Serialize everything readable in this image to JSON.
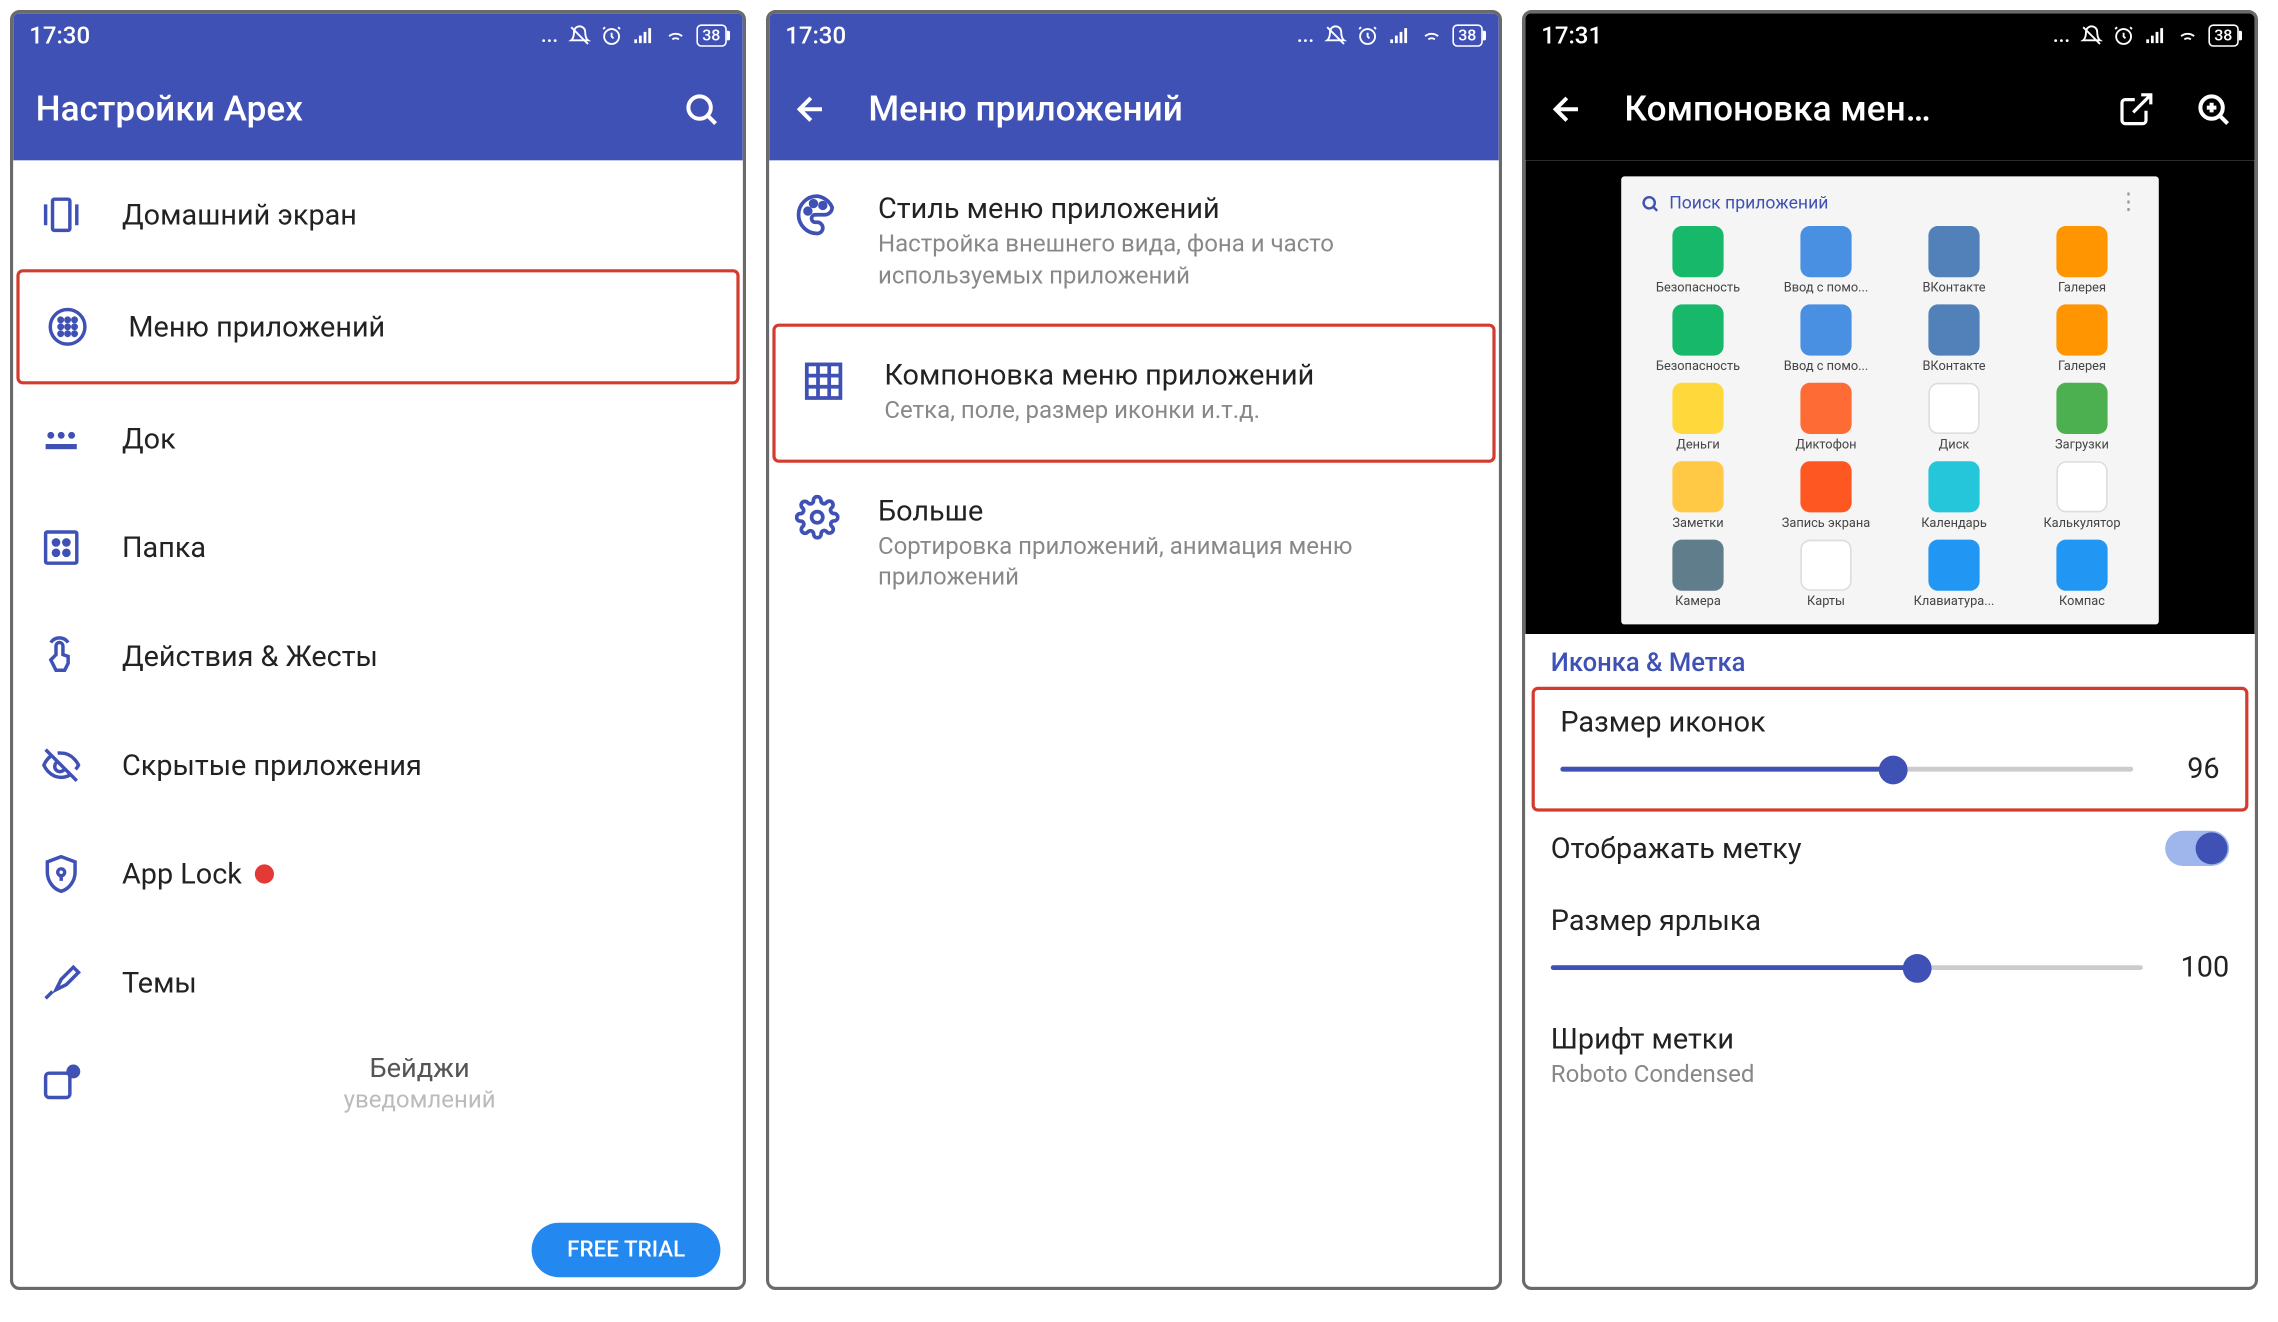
{
  "colors": {
    "primary": "#3f51b5",
    "accent": "#d33b2f"
  },
  "status": {
    "time1": "17:30",
    "time2": "17:30",
    "time3": "17:31",
    "dots": "...",
    "battery": "38"
  },
  "screen1": {
    "title": "Настройки Apex",
    "items": [
      {
        "icon": "home-screen",
        "label": "Домашний экран"
      },
      {
        "icon": "app-menu",
        "label": "Меню приложений",
        "hl": true
      },
      {
        "icon": "dock",
        "label": "Док"
      },
      {
        "icon": "folder",
        "label": "Папка"
      },
      {
        "icon": "gestures",
        "label": "Действия & Жесты"
      },
      {
        "icon": "hidden",
        "label": "Скрытые приложения"
      },
      {
        "icon": "applock",
        "label": "App Lock",
        "reddot": true
      },
      {
        "icon": "themes",
        "label": "Темы"
      }
    ],
    "badges_title": "Бейджи",
    "badges_sub": "уведомлений",
    "free_trial": "FREE TRIAL"
  },
  "screen2": {
    "title": "Меню приложений",
    "items": [
      {
        "icon": "palette",
        "title": "Стиль меню приложений",
        "sub": "Настройка внешнего вида, фона и часто используемых приложений"
      },
      {
        "icon": "grid",
        "title": "Компоновка меню приложений",
        "sub": "Сетка, поле, размер иконки и.т.д.",
        "hl": true
      },
      {
        "icon": "gear",
        "title": "Больше",
        "sub": "Сортировка приложений, анимация меню приложений"
      }
    ]
  },
  "screen3": {
    "title": "Компоновка мен…",
    "preview_search": "Поиск приложений",
    "apps": [
      {
        "label": "Безопасность",
        "color": "#18b86b"
      },
      {
        "label": "Ввод с помо...",
        "color": "#4a90e2"
      },
      {
        "label": "ВКонтакте",
        "color": "#5181b8"
      },
      {
        "label": "Галерея",
        "color": "#ff9500"
      },
      {
        "label": "Безопасность",
        "color": "#18b86b"
      },
      {
        "label": "Ввод с помо...",
        "color": "#4a90e2"
      },
      {
        "label": "ВКонтакте",
        "color": "#5181b8"
      },
      {
        "label": "Галерея",
        "color": "#ff9500"
      },
      {
        "label": "Деньги",
        "color": "#ffd93b"
      },
      {
        "label": "Диктофон",
        "color": "#ff6b35"
      },
      {
        "label": "Диск",
        "color": "#ffffff"
      },
      {
        "label": "Загрузки",
        "color": "#4caf50"
      },
      {
        "label": "Заметки",
        "color": "#ffc845"
      },
      {
        "label": "Запись экрана",
        "color": "#ff5722"
      },
      {
        "label": "Календарь",
        "color": "#26c6da"
      },
      {
        "label": "Калькулятор",
        "color": "#ffffff"
      },
      {
        "label": "Камера",
        "color": "#607d8b"
      },
      {
        "label": "Карты",
        "color": "#ffffff"
      },
      {
        "label": "Клавиатура...",
        "color": "#2196f3"
      },
      {
        "label": "Компас",
        "color": "#2196f3"
      }
    ],
    "section": "Иконка & Метка",
    "icon_size_label": "Размер иконок",
    "icon_size_value": "96",
    "icon_size_pct": 58,
    "show_label": "Отображать метку",
    "label_size_label": "Размер ярлыка",
    "label_size_value": "100",
    "label_size_pct": 62,
    "font_label": "Шрифт метки",
    "font_value": "Roboto Condensed"
  }
}
